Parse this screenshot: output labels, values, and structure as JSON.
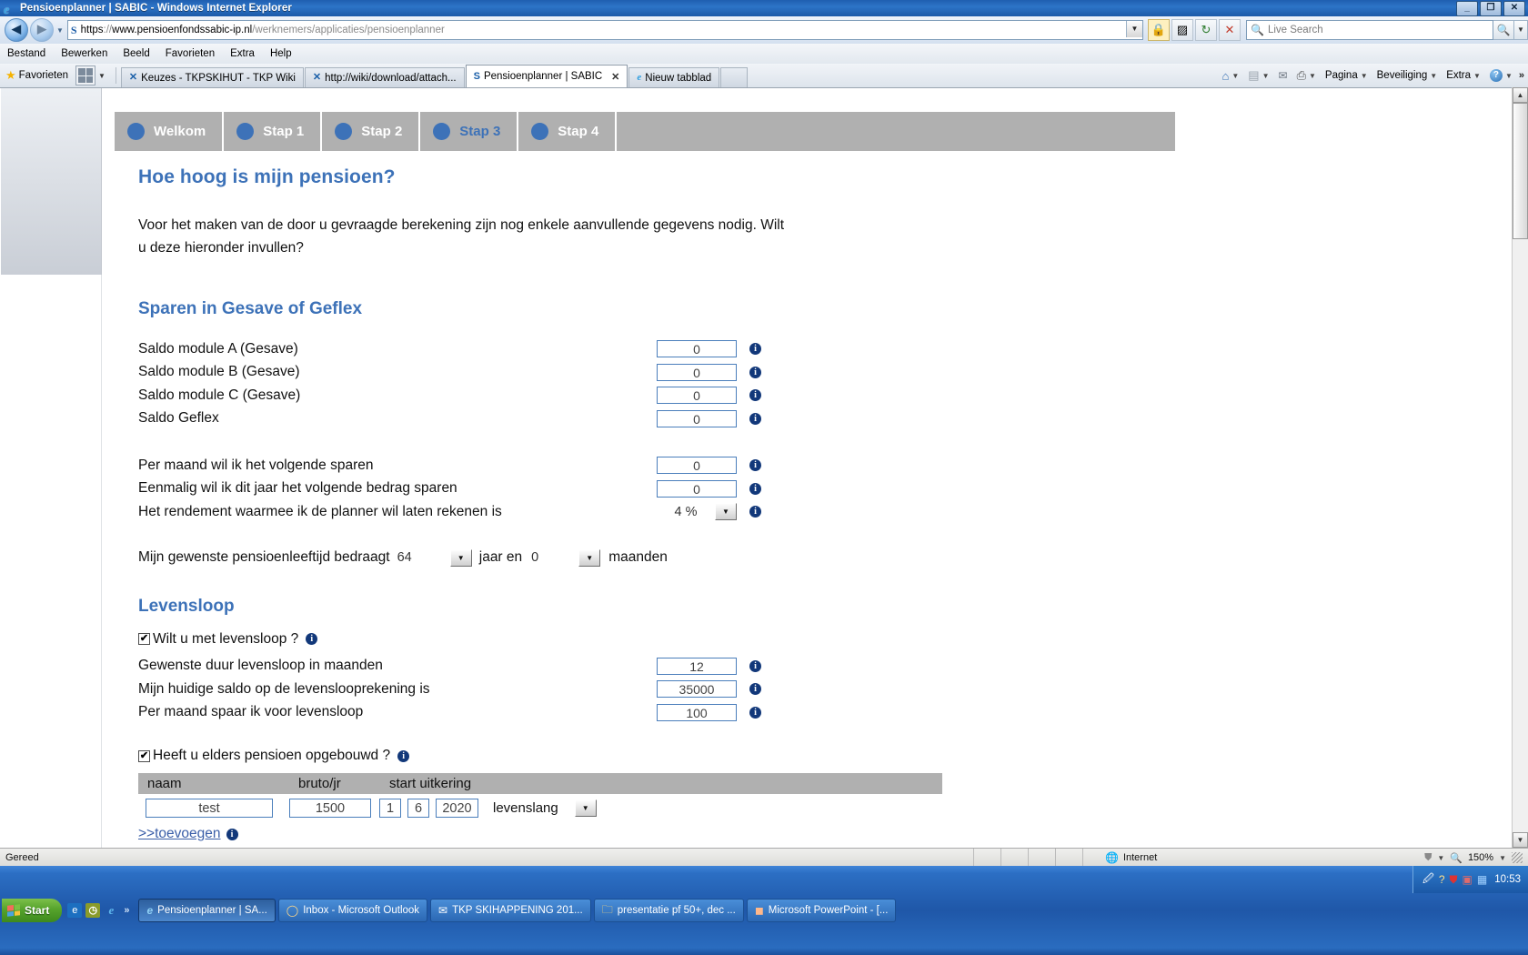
{
  "window": {
    "title": "Pensioenplanner | SABIC - Windows Internet Explorer",
    "minimize": "_",
    "restore": "❐",
    "close": "✕"
  },
  "nav": {
    "back_icon": "◀",
    "forward_icon": "▶",
    "history_caret": "▼",
    "address_protocol": "https",
    "address_sep": "://",
    "address_host": "www.pensioenfondssabic-ip.nl",
    "address_path": "/werknemers/applicaties/pensioenplanner",
    "address_dropdown": "▼",
    "lock_icon": "🔒",
    "compat_icon": "▨",
    "refresh_icon": "↻",
    "stop_icon": "✕",
    "search_placeholder": "Live Search",
    "search_go": "🔍",
    "search_caret": "▼"
  },
  "menubar": {
    "items": [
      "Bestand",
      "Bewerken",
      "Beeld",
      "Favorieten",
      "Extra",
      "Help"
    ]
  },
  "favbar": {
    "label": "Favorieten",
    "grid_caret": "▼"
  },
  "tabs": [
    {
      "label": "Keuzes - TKPSKIHUT - TKP Wiki",
      "icon": "X",
      "active": false,
      "closable": false
    },
    {
      "label": "http://wiki/download/attach...",
      "icon": "X",
      "active": false,
      "closable": false
    },
    {
      "label": "Pensioenplanner | SABIC",
      "icon": "S",
      "active": true,
      "closable": true,
      "close": "✕"
    },
    {
      "label": "Nieuw tabblad",
      "icon": "e",
      "active": false,
      "closable": false
    }
  ],
  "commandbar": {
    "items": [
      {
        "label": "",
        "icon": "home-icon",
        "glyph": "🏠",
        "caret": "▼"
      },
      {
        "label": "",
        "icon": "rss-icon",
        "glyph": "▤",
        "caret": "▼"
      },
      {
        "label": "",
        "icon": "mail-icon",
        "glyph": "✉",
        "caret": ""
      },
      {
        "label": "",
        "icon": "print-icon",
        "glyph": "🖶",
        "caret": "▼"
      },
      {
        "label": "Pagina",
        "icon": "page-menu",
        "glyph": "",
        "caret": "▼"
      },
      {
        "label": "Beveiliging",
        "icon": "security-menu",
        "glyph": "",
        "caret": "▼"
      },
      {
        "label": "Extra",
        "icon": "tools-menu",
        "glyph": "",
        "caret": "▼"
      },
      {
        "label": "",
        "icon": "help-icon",
        "glyph": "?",
        "caret": "▼"
      }
    ],
    "overflow": "»"
  },
  "steps": [
    {
      "label": "Welkom",
      "current": false
    },
    {
      "label": "Stap 1",
      "current": false
    },
    {
      "label": "Stap 2",
      "current": false
    },
    {
      "label": "Stap 3",
      "current": true
    },
    {
      "label": "Stap 4",
      "current": false
    }
  ],
  "page": {
    "title": "Hoe hoog is mijn pensioen?",
    "intro_line1": "Voor het maken van de door u gevraagde berekening zijn nog enkele aanvullende gegevens nodig. Wilt",
    "intro_line2": "u deze hieronder invullen?",
    "section_sparen": "Sparen in Gesave of Geflex",
    "section_levensloop": "Levensloop",
    "info_icon": "i"
  },
  "sparen_rows": [
    {
      "label": "Saldo module A (Gesave)",
      "value": "0"
    },
    {
      "label": "Saldo module B (Gesave)",
      "value": "0"
    },
    {
      "label": "Saldo module C (Gesave)",
      "value": "0"
    },
    {
      "label": "Saldo Geflex",
      "value": "0"
    }
  ],
  "sparen_rows2": [
    {
      "label": "Per maand wil ik het volgende sparen",
      "value": "0"
    },
    {
      "label": "Eenmalig wil ik dit jaar het volgende bedrag sparen",
      "value": "0"
    }
  ],
  "rendement": {
    "label": "Het rendement waarmee ik de planner wil laten rekenen is",
    "value": "4 %",
    "caret": "▼"
  },
  "pensioenleeftijd": {
    "label": "Mijn gewenste pensioenleeftijd bedraagt",
    "years": "64",
    "years_caret": "▼",
    "mid_label": "jaar en",
    "months": "0",
    "months_caret": "▼",
    "unit_label": "maanden"
  },
  "levensloop": {
    "checkbox_label": "Wilt u met levensloop ?",
    "checkbox_checked": "✔",
    "rows": [
      {
        "label": "Gewenste duur levensloop in maanden",
        "value": "12"
      },
      {
        "label": "Mijn huidige saldo op de levenslooprekening is",
        "value": "35000"
      },
      {
        "label": "Per maand spaar ik voor levensloop",
        "value": "100"
      }
    ]
  },
  "elders": {
    "checkbox_label": "Heeft u elders pensioen opgebouwd ?",
    "checkbox_checked": "✔",
    "columns": [
      "naam",
      "bruto/jr",
      "start uitkering"
    ],
    "rows": [
      {
        "naam": "test",
        "bruto": "1500",
        "dag": "1",
        "maand": "6",
        "jaar": "2020",
        "duur": "levenslang",
        "caret": "▼"
      }
    ],
    "add_link": ">>toevoegen"
  },
  "scrollbar": {
    "up": "▲",
    "down": "▼"
  },
  "statusbar": {
    "text": "Gereed",
    "zone": "Internet",
    "zone_icon": "🌐",
    "protect_icon": "⛊",
    "protect_caret": "▼",
    "zoom_icon": "🔍",
    "zoom": "150%",
    "zoom_caret": "▼"
  },
  "taskbar": {
    "start": "Start",
    "quick_overflow": "»",
    "tasks": [
      {
        "label": "Pensioenplanner | SA...",
        "icon": "e",
        "active": true
      },
      {
        "label": "Inbox - Microsoft Outlook",
        "icon": "O",
        "active": false
      },
      {
        "label": "TKP SKIHAPPENING 201...",
        "icon": "✉",
        "active": false
      },
      {
        "label": "presentatie pf 50+, dec ...",
        "icon": "📁",
        "active": false
      },
      {
        "label": "Microsoft PowerPoint - [...",
        "icon": "P",
        "active": false
      }
    ],
    "clock": "10:53",
    "tray_icons": [
      "🖉",
      "?",
      "🛡",
      "🔰",
      "📶"
    ]
  }
}
